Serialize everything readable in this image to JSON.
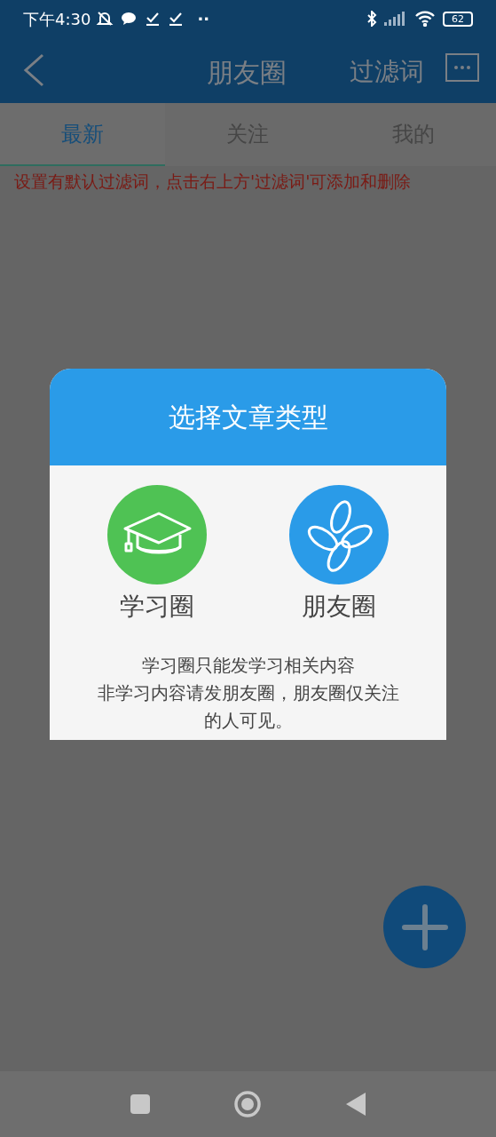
{
  "status_bar": {
    "time": "下午4:30",
    "dots": "··",
    "battery": "62"
  },
  "header": {
    "title": "朋友圈",
    "action": "过滤词"
  },
  "tabs": [
    {
      "label": "最新",
      "selected": true
    },
    {
      "label": "关注",
      "selected": false
    },
    {
      "label": "我的",
      "selected": false
    }
  ],
  "notice": "设置有默认过滤词，点击右上方'过滤词'可添加和删除",
  "dialog": {
    "title": "选择文章类型",
    "options": [
      {
        "kind": "study",
        "label": "学习圈"
      },
      {
        "kind": "friends",
        "label": "朋友圈"
      }
    ],
    "description": [
      "学习圈只能发学习相关内容",
      "非学习内容请发朋友圈，朋友圈仅关注的人可见。"
    ]
  }
}
